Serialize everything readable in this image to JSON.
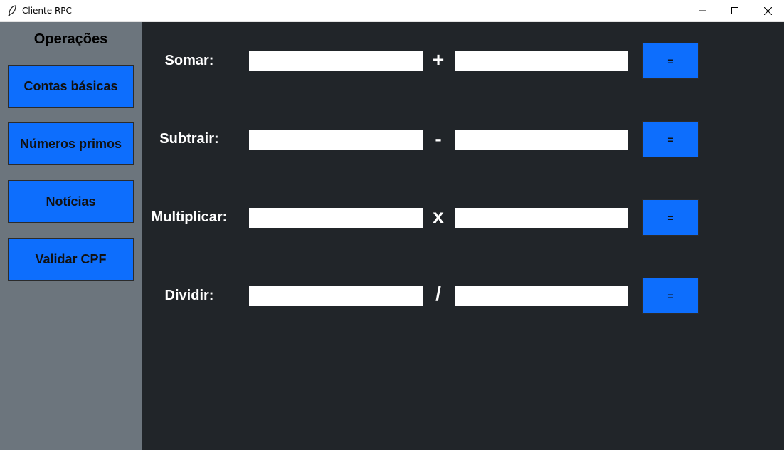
{
  "window": {
    "title": "Cliente RPC"
  },
  "sidebar": {
    "title": "Operações",
    "items": [
      {
        "label": "Contas básicas"
      },
      {
        "label": "Números primos"
      },
      {
        "label": "Notícias"
      },
      {
        "label": "Validar CPF"
      }
    ]
  },
  "operations": [
    {
      "label": "Somar:",
      "symbol": "+",
      "button": "=",
      "value_a": "",
      "value_b": ""
    },
    {
      "label": "Subtrair:",
      "symbol": "-",
      "button": "=",
      "value_a": "",
      "value_b": ""
    },
    {
      "label": "Multiplicar:",
      "symbol": "x",
      "button": "=",
      "value_a": "",
      "value_b": ""
    },
    {
      "label": "Dividir:",
      "symbol": "/",
      "button": "=",
      "value_a": "",
      "value_b": ""
    }
  ],
  "colors": {
    "sidebar_bg": "#6c757d",
    "main_bg": "#212529",
    "button_accent": "#0d6efd"
  },
  "icons": {
    "app": "feather-icon",
    "minimize": "minimize-icon",
    "maximize": "maximize-icon",
    "close": "close-icon"
  }
}
